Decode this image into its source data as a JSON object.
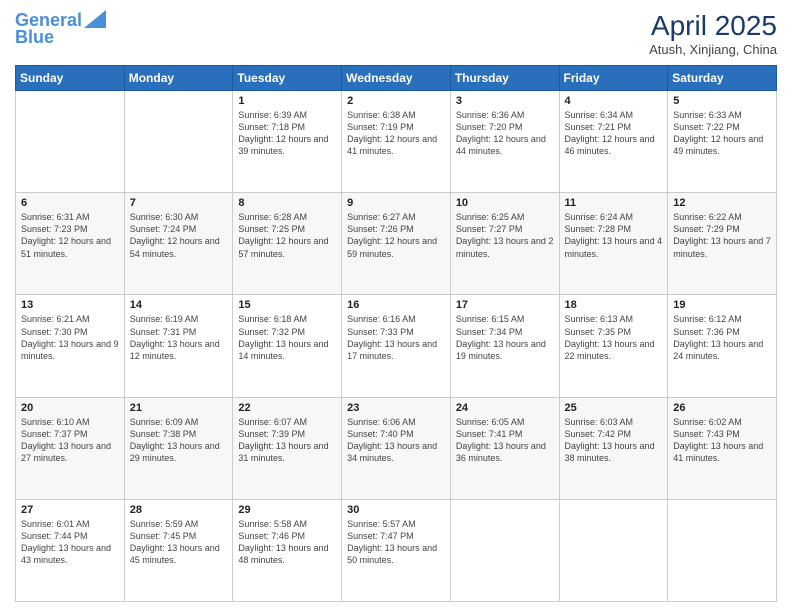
{
  "logo": {
    "line1": "General",
    "line2": "Blue"
  },
  "title": "April 2025",
  "subtitle": "Atush, Xinjiang, China",
  "headers": [
    "Sunday",
    "Monday",
    "Tuesday",
    "Wednesday",
    "Thursday",
    "Friday",
    "Saturday"
  ],
  "weeks": [
    [
      {
        "day": "",
        "info": ""
      },
      {
        "day": "",
        "info": ""
      },
      {
        "day": "1",
        "info": "Sunrise: 6:39 AM\nSunset: 7:18 PM\nDaylight: 12 hours and 39 minutes."
      },
      {
        "day": "2",
        "info": "Sunrise: 6:38 AM\nSunset: 7:19 PM\nDaylight: 12 hours and 41 minutes."
      },
      {
        "day": "3",
        "info": "Sunrise: 6:36 AM\nSunset: 7:20 PM\nDaylight: 12 hours and 44 minutes."
      },
      {
        "day": "4",
        "info": "Sunrise: 6:34 AM\nSunset: 7:21 PM\nDaylight: 12 hours and 46 minutes."
      },
      {
        "day": "5",
        "info": "Sunrise: 6:33 AM\nSunset: 7:22 PM\nDaylight: 12 hours and 49 minutes."
      }
    ],
    [
      {
        "day": "6",
        "info": "Sunrise: 6:31 AM\nSunset: 7:23 PM\nDaylight: 12 hours and 51 minutes."
      },
      {
        "day": "7",
        "info": "Sunrise: 6:30 AM\nSunset: 7:24 PM\nDaylight: 12 hours and 54 minutes."
      },
      {
        "day": "8",
        "info": "Sunrise: 6:28 AM\nSunset: 7:25 PM\nDaylight: 12 hours and 57 minutes."
      },
      {
        "day": "9",
        "info": "Sunrise: 6:27 AM\nSunset: 7:26 PM\nDaylight: 12 hours and 59 minutes."
      },
      {
        "day": "10",
        "info": "Sunrise: 6:25 AM\nSunset: 7:27 PM\nDaylight: 13 hours and 2 minutes."
      },
      {
        "day": "11",
        "info": "Sunrise: 6:24 AM\nSunset: 7:28 PM\nDaylight: 13 hours and 4 minutes."
      },
      {
        "day": "12",
        "info": "Sunrise: 6:22 AM\nSunset: 7:29 PM\nDaylight: 13 hours and 7 minutes."
      }
    ],
    [
      {
        "day": "13",
        "info": "Sunrise: 6:21 AM\nSunset: 7:30 PM\nDaylight: 13 hours and 9 minutes."
      },
      {
        "day": "14",
        "info": "Sunrise: 6:19 AM\nSunset: 7:31 PM\nDaylight: 13 hours and 12 minutes."
      },
      {
        "day": "15",
        "info": "Sunrise: 6:18 AM\nSunset: 7:32 PM\nDaylight: 13 hours and 14 minutes."
      },
      {
        "day": "16",
        "info": "Sunrise: 6:16 AM\nSunset: 7:33 PM\nDaylight: 13 hours and 17 minutes."
      },
      {
        "day": "17",
        "info": "Sunrise: 6:15 AM\nSunset: 7:34 PM\nDaylight: 13 hours and 19 minutes."
      },
      {
        "day": "18",
        "info": "Sunrise: 6:13 AM\nSunset: 7:35 PM\nDaylight: 13 hours and 22 minutes."
      },
      {
        "day": "19",
        "info": "Sunrise: 6:12 AM\nSunset: 7:36 PM\nDaylight: 13 hours and 24 minutes."
      }
    ],
    [
      {
        "day": "20",
        "info": "Sunrise: 6:10 AM\nSunset: 7:37 PM\nDaylight: 13 hours and 27 minutes."
      },
      {
        "day": "21",
        "info": "Sunrise: 6:09 AM\nSunset: 7:38 PM\nDaylight: 13 hours and 29 minutes."
      },
      {
        "day": "22",
        "info": "Sunrise: 6:07 AM\nSunset: 7:39 PM\nDaylight: 13 hours and 31 minutes."
      },
      {
        "day": "23",
        "info": "Sunrise: 6:06 AM\nSunset: 7:40 PM\nDaylight: 13 hours and 34 minutes."
      },
      {
        "day": "24",
        "info": "Sunrise: 6:05 AM\nSunset: 7:41 PM\nDaylight: 13 hours and 36 minutes."
      },
      {
        "day": "25",
        "info": "Sunrise: 6:03 AM\nSunset: 7:42 PM\nDaylight: 13 hours and 38 minutes."
      },
      {
        "day": "26",
        "info": "Sunrise: 6:02 AM\nSunset: 7:43 PM\nDaylight: 13 hours and 41 minutes."
      }
    ],
    [
      {
        "day": "27",
        "info": "Sunrise: 6:01 AM\nSunset: 7:44 PM\nDaylight: 13 hours and 43 minutes."
      },
      {
        "day": "28",
        "info": "Sunrise: 5:59 AM\nSunset: 7:45 PM\nDaylight: 13 hours and 45 minutes."
      },
      {
        "day": "29",
        "info": "Sunrise: 5:58 AM\nSunset: 7:46 PM\nDaylight: 13 hours and 48 minutes."
      },
      {
        "day": "30",
        "info": "Sunrise: 5:57 AM\nSunset: 7:47 PM\nDaylight: 13 hours and 50 minutes."
      },
      {
        "day": "",
        "info": ""
      },
      {
        "day": "",
        "info": ""
      },
      {
        "day": "",
        "info": ""
      }
    ]
  ]
}
